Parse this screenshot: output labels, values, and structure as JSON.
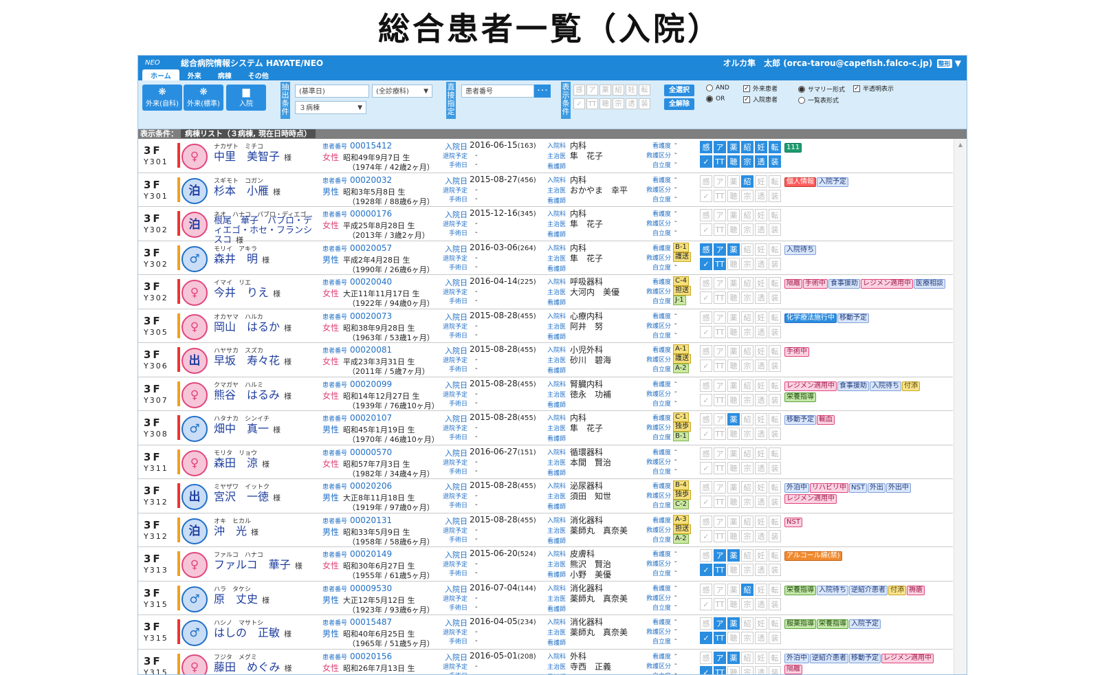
{
  "page_title": "総合患者一覧（入院）",
  "app": {
    "logo": "NEO",
    "system_name": "総合病院情報システム HAYATE/NEO",
    "user": "オルカ隼　太郎 (orca-tarou@capefish.falco-c.jp)",
    "user_menu": "整形"
  },
  "tabs": [
    "ホーム",
    "外来",
    "病棟",
    "その他"
  ],
  "toolbar": {
    "buttons": [
      {
        "label": "外来(自科)",
        "icon": "outpatient-own-icon"
      },
      {
        "label": "外来(標準)",
        "icon": "outpatient-standard-icon"
      },
      {
        "label": "入院",
        "icon": "inpatient-bed-icon"
      }
    ],
    "extract_label": "抽出条件",
    "base_date_placeholder": "(基準日)",
    "dept_select": "(全診療科)",
    "ward_select": "３病棟",
    "direct_label": "直接指定",
    "patient_no_placeholder": "患者番号",
    "search_button": "･･･",
    "display_label": "表示条件",
    "filter_icons": [
      "感",
      "ア",
      "薬",
      "紹",
      "妊",
      "転",
      "✓",
      "TT",
      "聴",
      "宗",
      "透",
      "装"
    ],
    "select_all": "全選択",
    "deselect_all": "全解除",
    "options": {
      "and": "AND",
      "or": "OR",
      "outpatient": "外来患者",
      "inpatient": "入院患者",
      "summary": "サマリー形式",
      "list_format": "一覧表形式",
      "translucent": "半透明表示"
    }
  },
  "condition_bar": {
    "label": "表示条件：",
    "value": "病棟リスト（３病棟, 現在日時時点）"
  },
  "labels": {
    "patient_no": "患者番号",
    "admit_date": "入院日",
    "discharge_plan": "退院予定",
    "surgery_date": "手術日",
    "dept": "入院科",
    "doctor": "主治医",
    "nurse": "看護師",
    "care_level": "看護度",
    "transport": "救護区分",
    "independence": "自立度",
    "honorific": "様",
    "dash": "-"
  },
  "patients": [
    {
      "floor": "3F",
      "room": "Y301",
      "kana": "ナカザト　ミチコ",
      "name": "中里　美智子",
      "avatar": "♀",
      "id": "00015412",
      "sex": "女性",
      "birth": "昭和49年9月7日 生",
      "age": "（1974年 / 42歳2ヶ月）",
      "admit": "2016-06-15",
      "days": "(163)",
      "dept": "内科",
      "doctor": "隼　花子",
      "nurse": "",
      "care": "",
      "transport": "",
      "indep": "",
      "grid": "111111",
      "tags": [
        [
          "111",
          "teal"
        ]
      ]
    },
    {
      "floor": "3F",
      "room": "Y301",
      "kana": "スギモト　コガン",
      "name": "杉本　小雁",
      "avatar": "泊",
      "id": "00020032",
      "sex": "男性",
      "birth": "昭和3年5月8日 生",
      "age": "（1928年 / 88歳6ヶ月）",
      "admit": "2015-08-27",
      "days": "(456)",
      "dept": "内科",
      "doctor": "おかやま　幸平",
      "nurse": "",
      "care": "",
      "transport": "",
      "indep": "",
      "grid": "000100",
      "tags": [
        [
          "個人情報",
          "red"
        ],
        [
          "入院予定",
          "blue"
        ]
      ]
    },
    {
      "floor": "3F",
      "room": "Y302",
      "kana": "ネオ　ハナコ　パブロ・ディエゴ…",
      "name": "根尾　華子　パブロ・ディエゴ・ホセ・フランシスコ",
      "avatar": "泊",
      "id": "00000176",
      "sex": "女性",
      "birth": "平成25年8月28日 生",
      "age": "（2013年 / 3歳2ヶ月）",
      "admit": "2015-12-16",
      "days": "(345)",
      "dept": "内科",
      "doctor": "隼　花子",
      "nurse": "",
      "care": "",
      "transport": "",
      "indep": "",
      "grid": "000000",
      "tags": []
    },
    {
      "floor": "3F",
      "room": "Y302",
      "kana": "モリイ　アキラ",
      "name": "森井　明",
      "avatar": "♂",
      "id": "00020057",
      "sex": "男性",
      "birth": "平成2年4月28日 生",
      "age": "（1990年 / 26歳6ヶ月）",
      "admit": "2016-03-06",
      "days": "(264)",
      "dept": "内科",
      "doctor": "隼　花子",
      "nurse": "",
      "care": "B-1",
      "transport": "護送",
      "indep": "",
      "grid": "111000",
      "tags": [
        [
          "入院待ち",
          "blue"
        ]
      ]
    },
    {
      "floor": "3F",
      "room": "Y302",
      "kana": "イマイ　リエ",
      "name": "今井　りえ",
      "avatar": "♀",
      "id": "00020040",
      "sex": "女性",
      "birth": "大正11年11月17日 生",
      "age": "（1922年 / 94歳0ヶ月）",
      "admit": "2016-04-14",
      "days": "(225)",
      "dept": "呼吸器科",
      "doctor": "大河内　美優",
      "nurse": "",
      "care": "C-4",
      "transport": "担送",
      "indep": "J-1",
      "grid": "000000",
      "tags": [
        [
          "隔離",
          "pink"
        ],
        [
          "手術中",
          "pink"
        ],
        [
          "食事援助",
          "blue"
        ],
        [
          "レジメン適用中",
          "pink"
        ],
        [
          "医療相談",
          "blue"
        ]
      ]
    },
    {
      "floor": "3F",
      "room": "Y305",
      "kana": "オカヤマ　ハルカ",
      "name": "岡山　はるか",
      "avatar": "♀",
      "id": "00020073",
      "sex": "女性",
      "birth": "昭和38年9月28日 生",
      "age": "（1963年 / 53歳1ヶ月）",
      "admit": "2015-08-28",
      "days": "(455)",
      "dept": "心療内科",
      "doctor": "阿井　努",
      "nurse": "",
      "care": "",
      "transport": "",
      "indep": "",
      "grid": "000000",
      "tags": [
        [
          "化学療法施行中",
          "dblue"
        ],
        [
          "移動予定",
          "blue"
        ]
      ]
    },
    {
      "floor": "3F",
      "room": "Y306",
      "kana": "ハヤサカ　スズカ",
      "name": "早坂　寿々花",
      "avatar": "出",
      "id": "00020081",
      "sex": "女性",
      "birth": "平成23年3月31日 生",
      "age": "（2011年 / 5歳7ヶ月）",
      "admit": "2015-08-28",
      "days": "(455)",
      "dept": "小児外科",
      "doctor": "砂川　碧海",
      "nurse": "",
      "care": "A-1",
      "transport": "護送",
      "indep": "A-2",
      "grid": "000000",
      "tags": [
        [
          "手術中",
          "pink"
        ]
      ]
    },
    {
      "floor": "3F",
      "room": "Y307",
      "kana": "クマガヤ　ハルミ",
      "name": "熊谷　はるみ",
      "avatar": "♀",
      "id": "00020099",
      "sex": "女性",
      "birth": "昭和14年12月27日 生",
      "age": "（1939年 / 76歳10ヶ月）",
      "admit": "2015-08-28",
      "days": "(455)",
      "dept": "腎臓内科",
      "doctor": "徳永　功補",
      "nurse": "",
      "care": "",
      "transport": "",
      "indep": "",
      "grid": "000000",
      "tags": [
        [
          "レジメン適用中",
          "pink"
        ],
        [
          "食事援助",
          "blue"
        ],
        [
          "入院待ち",
          "blue"
        ],
        [
          "付添",
          "yellow"
        ],
        [
          "栄養指導",
          "green"
        ]
      ]
    },
    {
      "floor": "3F",
      "room": "Y308",
      "kana": "ハタナカ　シンイチ",
      "name": "畑中　真一",
      "avatar": "♂",
      "id": "00020107",
      "sex": "男性",
      "birth": "昭和45年1月19日 生",
      "age": "（1970年 / 46歳10ヶ月）",
      "admit": "2015-08-28",
      "days": "(455)",
      "dept": "内科",
      "doctor": "隼　花子",
      "nurse": "",
      "care": "C-1",
      "transport": "独歩",
      "indep": "B-1",
      "grid": "001000",
      "tags": [
        [
          "移動予定",
          "blue"
        ],
        [
          "輸血",
          "pink"
        ]
      ]
    },
    {
      "floor": "3F",
      "room": "Y311",
      "kana": "モリタ　リョウ",
      "name": "森田　涼",
      "avatar": "♀",
      "id": "00000570",
      "sex": "女性",
      "birth": "昭和57年7月3日 生",
      "age": "（1982年 / 34歳4ヶ月）",
      "admit": "2016-06-27",
      "days": "(151)",
      "dept": "循環器科",
      "doctor": "本間　賢治",
      "nurse": "",
      "care": "",
      "transport": "",
      "indep": "",
      "grid": "000000",
      "tags": []
    },
    {
      "floor": "3F",
      "room": "Y312",
      "kana": "ミヤザワ　イットク",
      "name": "宮沢　一徳",
      "avatar": "出",
      "id": "00020206",
      "sex": "男性",
      "birth": "大正8年11月18日 生",
      "age": "（1919年 / 97歳0ヶ月）",
      "admit": "2015-08-28",
      "days": "(455)",
      "dept": "泌尿器科",
      "doctor": "須田　知世",
      "nurse": "",
      "care": "B-4",
      "transport": "独歩",
      "indep": "C-2",
      "grid": "000000",
      "tags": [
        [
          "外泊中",
          "blue"
        ],
        [
          "リハビリ中",
          "pink"
        ],
        [
          "NST",
          "blue"
        ],
        [
          "外出",
          "blue"
        ],
        [
          "外出中",
          "blue"
        ],
        [
          "レジメン適用中",
          "pink"
        ]
      ]
    },
    {
      "floor": "3F",
      "room": "Y312",
      "kana": "オキ　ヒカル",
      "name": "沖　光",
      "avatar": "泊",
      "id": "00020131",
      "sex": "男性",
      "birth": "昭和33年5月9日 生",
      "age": "（1958年 / 58歳6ヶ月）",
      "admit": "2015-08-28",
      "days": "(455)",
      "dept": "消化器科",
      "doctor": "薬師丸　真奈美",
      "nurse": "",
      "care": "A-3",
      "transport": "担送",
      "indep": "A-2",
      "grid": "000000",
      "tags": [
        [
          "NST",
          "pink"
        ]
      ]
    },
    {
      "floor": "3F",
      "room": "Y313",
      "kana": "ファルコ　ハナコ",
      "name": "ファルコ　華子",
      "avatar": "♀",
      "id": "00020149",
      "sex": "女性",
      "birth": "昭和30年6月27日 生",
      "age": "（1955年 / 61歳5ヶ月）",
      "admit": "2015-06-20",
      "days": "(524)",
      "dept": "皮膚科",
      "doctor": "熊沢　賢治",
      "nurse": "小野　美優",
      "care": "",
      "transport": "",
      "indep": "",
      "grid": "011000",
      "tags": [
        [
          "アルコール綿(禁)",
          "orange"
        ]
      ]
    },
    {
      "floor": "3F",
      "room": "Y315",
      "kana": "ハラ　タケシ",
      "name": "原　丈史",
      "avatar": "♂",
      "id": "00009530",
      "sex": "男性",
      "birth": "大正12年5月12日 生",
      "age": "（1923年 / 93歳6ヶ月）",
      "admit": "2016-07-04",
      "days": "(144)",
      "dept": "消化器科",
      "doctor": "薬師丸　真奈美",
      "nurse": "",
      "care": "",
      "transport": "",
      "indep": "",
      "grid": "000100",
      "tags": [
        [
          "栄養指導",
          "green"
        ],
        [
          "入院待ち",
          "blue"
        ],
        [
          "逆紹介患者",
          "blue"
        ],
        [
          "付添",
          "yellow"
        ],
        [
          "褥瘡",
          "pink"
        ]
      ]
    },
    {
      "floor": "3F",
      "room": "Y315",
      "kana": "ハシノ　マサトシ",
      "name": "はしの　正敏",
      "avatar": "♂",
      "id": "00015487",
      "sex": "男性",
      "birth": "昭和40年6月25日 生",
      "age": "（1965年 / 51歳5ヶ月）",
      "admit": "2016-04-05",
      "days": "(234)",
      "dept": "消化器科",
      "doctor": "薬師丸　真奈美",
      "nurse": "",
      "care": "",
      "transport": "",
      "indep": "",
      "grid": "011000",
      "tags": [
        [
          "服薬指導",
          "green"
        ],
        [
          "栄養指導",
          "green"
        ],
        [
          "入院予定",
          "blue"
        ]
      ]
    },
    {
      "floor": "3F",
      "room": "Y315",
      "kana": "フジタ　メグミ",
      "name": "藤田　めぐみ",
      "avatar": "♀",
      "id": "00020156",
      "sex": "女性",
      "birth": "昭和26年7月13日 生",
      "age": "（1951年 / 65歳4ヶ月）",
      "admit": "2016-05-01",
      "days": "(208)",
      "dept": "外科",
      "doctor": "寺西　正義",
      "nurse": "",
      "care": "",
      "transport": "",
      "indep": "",
      "grid": "011000",
      "tags": [
        [
          "外泊中",
          "blue"
        ],
        [
          "逆紹介患者",
          "blue"
        ],
        [
          "移動予定",
          "blue"
        ],
        [
          "レジメン適用中",
          "pink"
        ],
        [
          "隔離",
          "pink"
        ]
      ]
    }
  ],
  "colors": {
    "accent": "#1f87d8",
    "female": "#e0457b",
    "male": "#1f6fc6"
  }
}
